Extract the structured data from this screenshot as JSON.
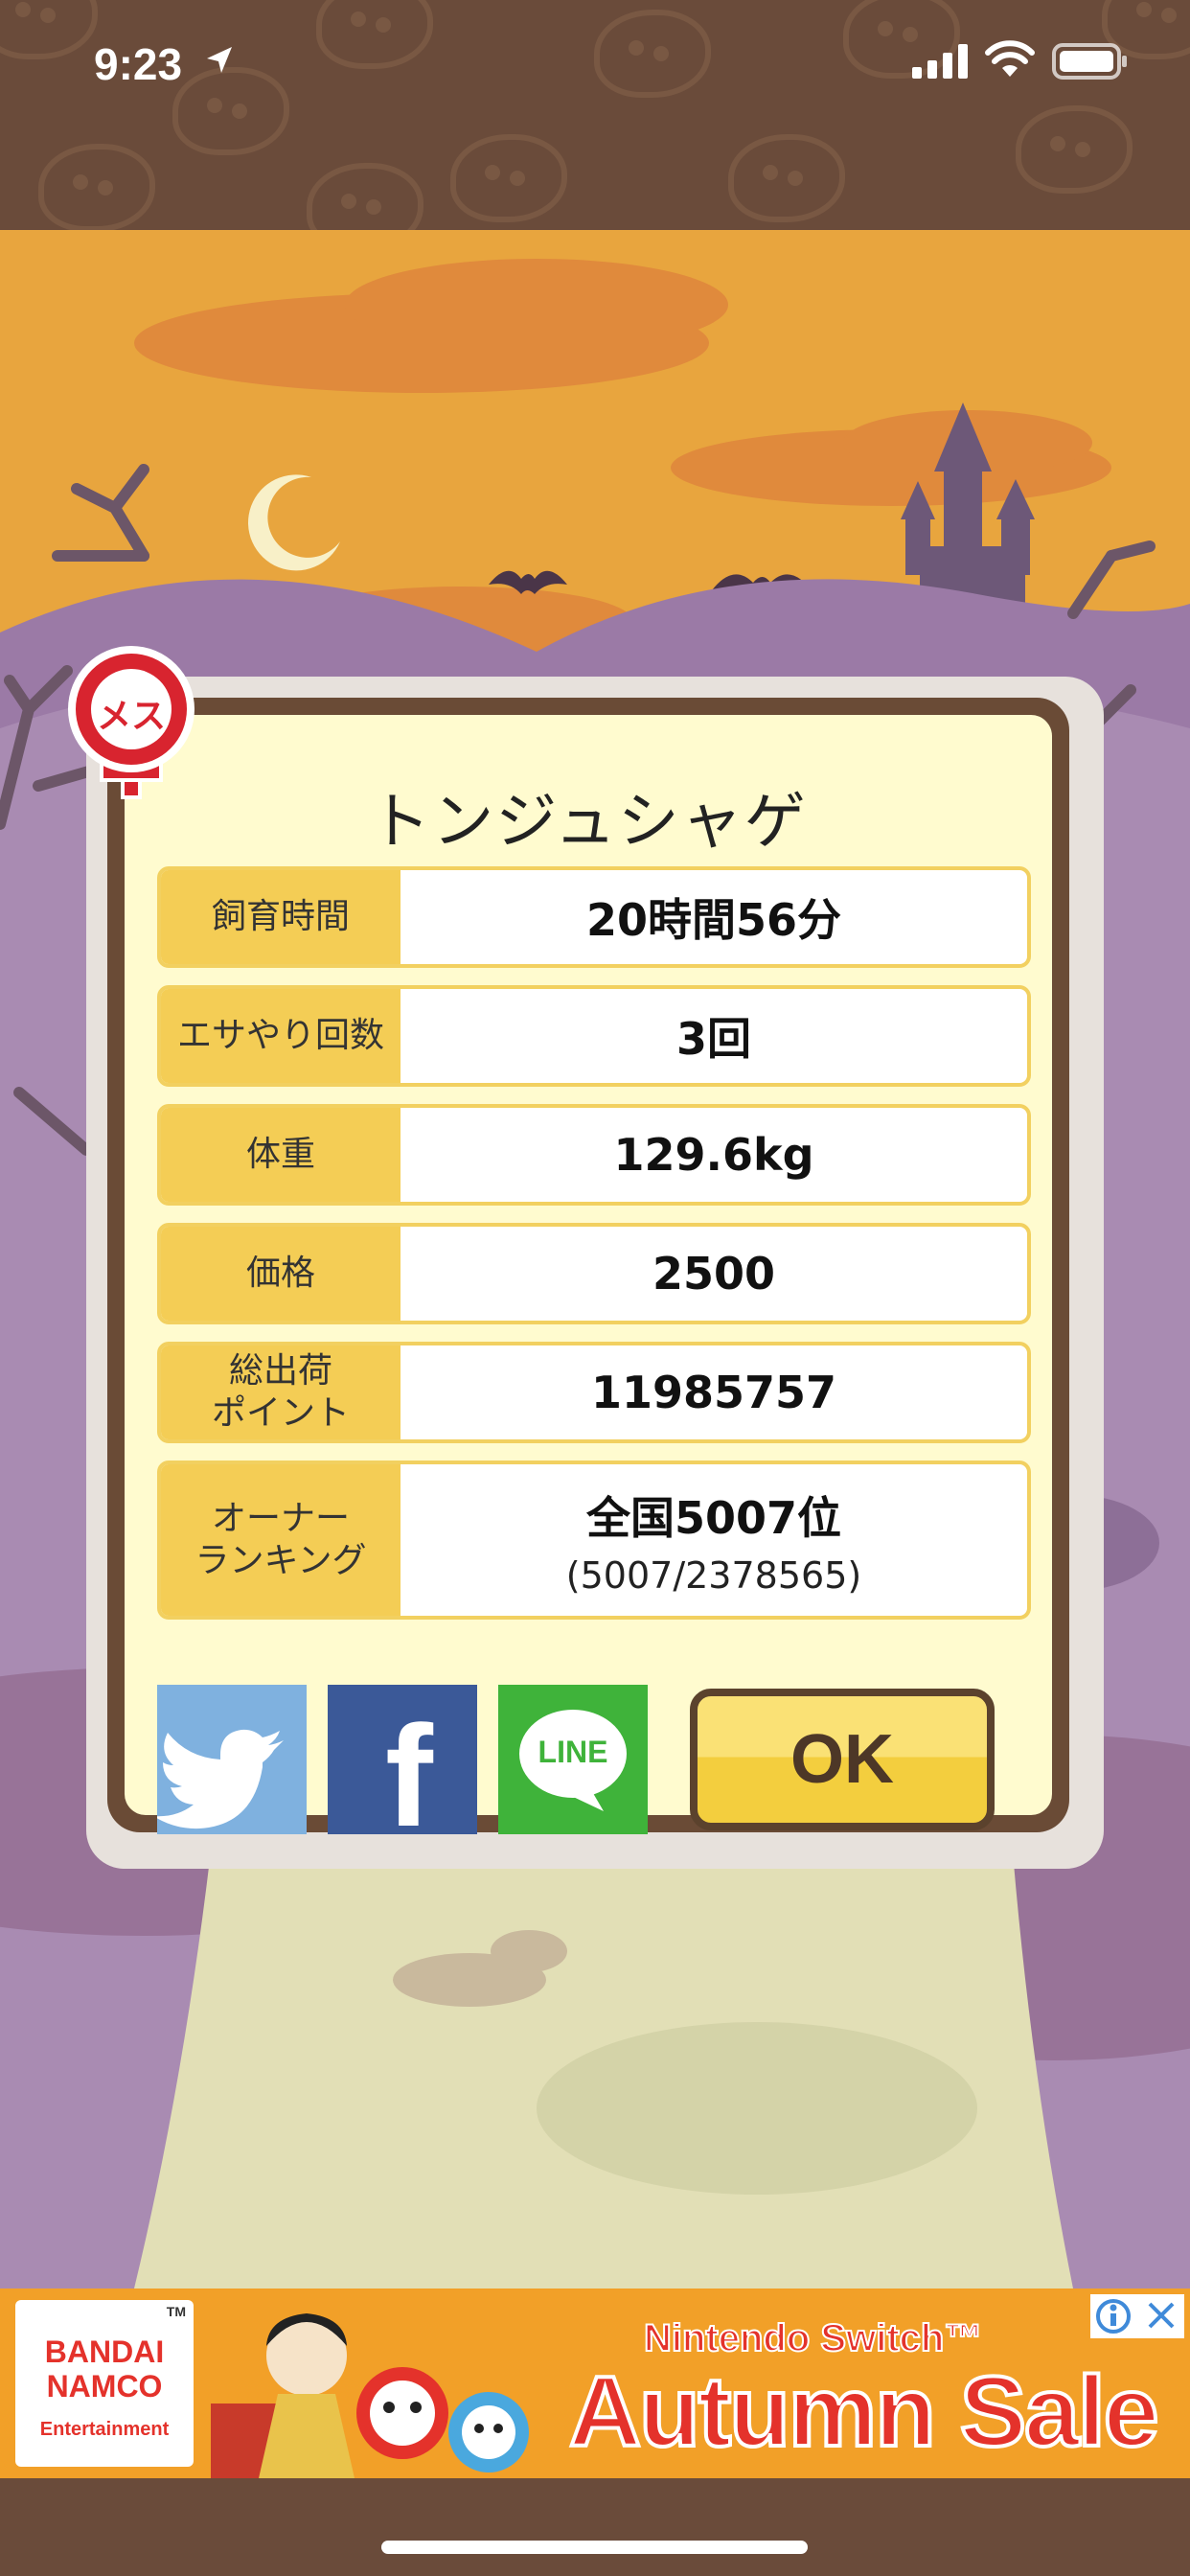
{
  "status_bar": {
    "time": "9:23"
  },
  "pet": {
    "name": "トンジュシャゲ",
    "sex_badge": "メス"
  },
  "stats": [
    {
      "label": "飼育時間",
      "value": "20時間56分"
    },
    {
      "label": "エサやり回数",
      "value": "3回"
    },
    {
      "label": "体重",
      "value": "129.6kg"
    },
    {
      "label": "価格",
      "value": "2500"
    },
    {
      "label": "総出荷\nポイント",
      "value": "11985757"
    }
  ],
  "ranking": {
    "label": "オーナー\nランキング",
    "value": "全国5007位",
    "detail": "(5007/2378565)"
  },
  "share": {
    "line_label": "LINE",
    "facebook_glyph": "f"
  },
  "ok_label": "OK",
  "ad": {
    "brand_line1": "BANDAI",
    "brand_line2": "NAMCO",
    "brand_line3": "Entertainment",
    "tm": "TM",
    "tagline": "Nintendo Switch™",
    "headline": "Autumn Sale"
  },
  "colors": {
    "panel_bg": "#fffbcf",
    "label_bg": "#f4cd55",
    "frame": "#6a4b36",
    "twitter": "#7fb1df",
    "facebook": "#3b5998",
    "line": "#3fb33a",
    "ok": "#f3ce3e"
  }
}
